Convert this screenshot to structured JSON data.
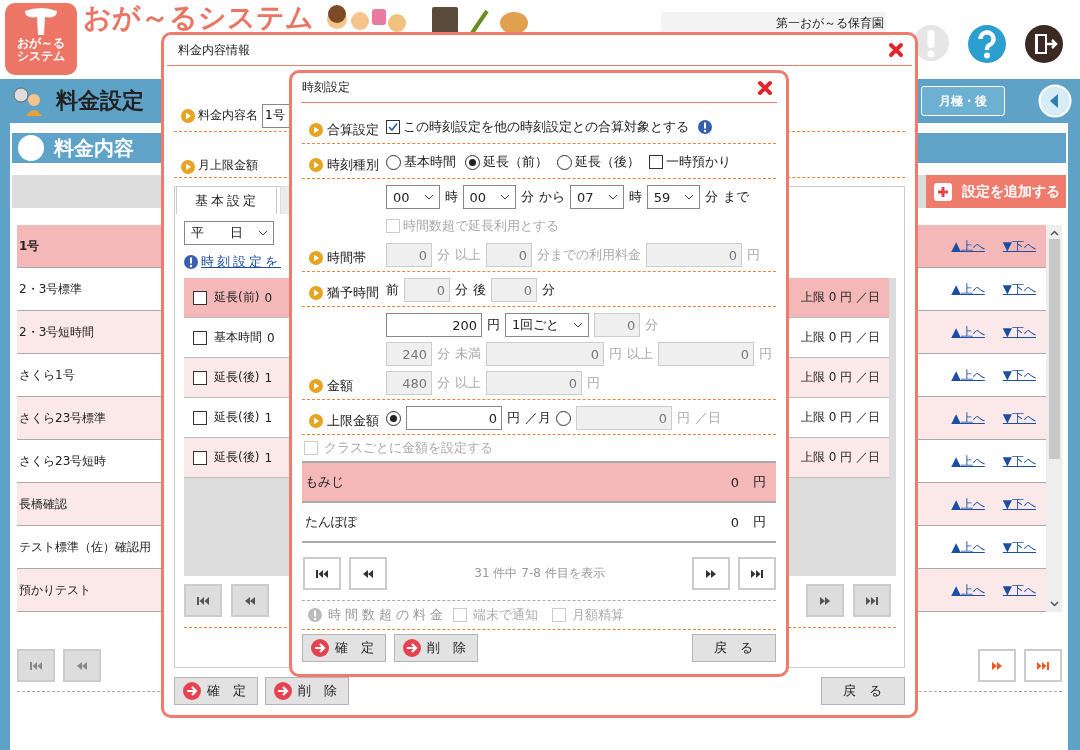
{
  "header": {
    "logo_lines": [
      "おが～る",
      "システム"
    ],
    "title": "おが～るシステム",
    "facility": "第一おが～る保育園"
  },
  "page_bar": {
    "title": "料金設定",
    "button": "月極・後"
  },
  "panel": {
    "title": "料金内容",
    "add_button": "設定を追加する",
    "rows": [
      {
        "name": "1号",
        "selected": true,
        "up": "▲上へ",
        "down": "▼下へ"
      },
      {
        "name": "2・3号標準",
        "selected": false,
        "up": "▲上へ",
        "down": "▼下へ"
      },
      {
        "name": "2・3号短時間",
        "selected": false,
        "up": "▲上へ",
        "down": "▼下へ"
      },
      {
        "name": "さくら1号",
        "selected": false,
        "up": "▲上へ",
        "down": "▼下へ"
      },
      {
        "name": "さくら23号標準",
        "selected": false,
        "up": "▲上へ",
        "down": "▼下へ"
      },
      {
        "name": "さくら23号短時",
        "selected": false,
        "up": "▲上へ",
        "down": "▼下へ"
      },
      {
        "name": "長橋確認",
        "selected": false,
        "up": "▲上へ",
        "down": "▼下へ"
      },
      {
        "name": "テスト標準（佐）確認用",
        "selected": false,
        "up": "▲上へ",
        "down": "▼下へ"
      },
      {
        "name": "預かりテスト",
        "selected": false,
        "up": "▲上へ",
        "down": "▼下へ"
      }
    ],
    "pager": [
      {
        "kind": "first",
        "disabled": true
      },
      {
        "kind": "prev",
        "disabled": true
      },
      {
        "kind": "next",
        "disabled": false
      },
      {
        "kind": "last",
        "disabled": false
      }
    ]
  },
  "fee_dialog": {
    "title": "料金内容情報",
    "fields": [
      {
        "label": "料金内容名",
        "value": "1号"
      },
      {
        "label": "月上限金額"
      }
    ],
    "tabs": [
      {
        "label": "基本設定",
        "selected": true
      },
      {
        "selected": false
      }
    ],
    "day_select": "平　　日",
    "info_link": "時刻設定を",
    "rows": [
      {
        "checked": false,
        "type": "延長(前)",
        "time": "0",
        "limit": "上限 0 円 ／日",
        "selected": true
      },
      {
        "checked": false,
        "type": "基本時間",
        "time": "0",
        "limit": "上限 0 円 ／日",
        "selected": false
      },
      {
        "checked": false,
        "type": "延長(後)",
        "time": "1",
        "limit": "上限 0 円 ／日",
        "selected": false
      },
      {
        "checked": false,
        "type": "延長(後)",
        "time": "1",
        "limit": "上限 0 円 ／日",
        "selected": false
      },
      {
        "checked": false,
        "type": "延長(後)",
        "time": "1",
        "limit": "上限 0 円 ／日",
        "selected": false
      }
    ],
    "pager": [
      {
        "kind": "first",
        "disabled": true
      },
      {
        "kind": "prev",
        "disabled": true
      },
      {
        "kind": "next",
        "disabled": true
      },
      {
        "kind": "last",
        "disabled": true
      }
    ],
    "buttons": [
      {
        "kind": "confirm",
        "label": "確　定"
      },
      {
        "kind": "delete",
        "label": "削　除"
      },
      {
        "kind": "back",
        "label": "戻　る"
      }
    ]
  },
  "time_dialog": {
    "title": "時刻設定",
    "sections": [
      {
        "label": "合算設定",
        "lines": [
          [
            {
              "kind": "checkbox",
              "label": "この時刻設定を他の時刻設定との合算対象とする",
              "checked": true,
              "disabled": false
            },
            {
              "kind": "info"
            }
          ]
        ]
      },
      {
        "label": "時刻種別",
        "lines": [
          [
            {
              "kind": "radio",
              "label": "基本時間",
              "selected": false
            },
            {
              "kind": "radio",
              "label": "延長（前）",
              "selected": true
            },
            {
              "kind": "radio",
              "label": "延長（後）",
              "selected": false
            },
            {
              "kind": "checkbox",
              "label": "一時預かり",
              "checked": false,
              "disabled": false
            }
          ]
        ]
      },
      {
        "label": "時間帯",
        "lines": [
          [
            {
              "kind": "select",
              "value": "00"
            },
            {
              "kind": "text",
              "text": "時",
              "disabled": false
            },
            {
              "kind": "select",
              "value": "00"
            },
            {
              "kind": "text",
              "text": "分",
              "disabled": false
            },
            {
              "kind": "text",
              "text": "から",
              "disabled": false
            },
            {
              "kind": "select",
              "value": "07"
            },
            {
              "kind": "text",
              "text": "時",
              "disabled": false
            },
            {
              "kind": "select",
              "value": "59"
            },
            {
              "kind": "text",
              "text": "分",
              "disabled": false
            },
            {
              "kind": "text",
              "text": "まで",
              "disabled": false
            }
          ],
          [
            {
              "kind": "checkbox",
              "label": "時間数超で延長利用とする",
              "checked": false,
              "disabled": true
            }
          ],
          [
            {
              "kind": "input",
              "value": "0",
              "disabled": true
            },
            {
              "kind": "text",
              "text": "分",
              "disabled": true
            },
            {
              "kind": "text",
              "text": "以上",
              "disabled": true
            },
            {
              "kind": "input",
              "value": "0",
              "disabled": true
            },
            {
              "kind": "text",
              "text": "分までの利用料金",
              "disabled": true
            },
            {
              "kind": "wideinput",
              "value": "0",
              "disabled": true
            },
            {
              "kind": "text",
              "text": "円",
              "disabled": true
            }
          ]
        ]
      },
      {
        "label": "猶予時間",
        "lines": [
          [
            {
              "kind": "text",
              "text": "前",
              "disabled": false
            },
            {
              "kind": "input",
              "value": "0",
              "disabled": true
            },
            {
              "kind": "text",
              "text": "分",
              "disabled": false
            },
            {
              "kind": "text",
              "text": "後",
              "disabled": false
            },
            {
              "kind": "input",
              "value": "0",
              "disabled": true
            },
            {
              "kind": "text",
              "text": "分",
              "disabled": false
            }
          ]
        ]
      },
      {
        "label": "金額",
        "lines": [
          [
            {
              "kind": "wideinput",
              "value": "200",
              "disabled": false
            },
            {
              "kind": "text",
              "text": "円",
              "disabled": false
            },
            {
              "kind": "select",
              "value": "1回ごと"
            },
            {
              "kind": "input",
              "value": "0",
              "disabled": true
            },
            {
              "kind": "text",
              "text": "分",
              "disabled": true
            }
          ],
          [
            {
              "kind": "input",
              "value": "240",
              "disabled": true
            },
            {
              "kind": "text",
              "text": "分",
              "disabled": true
            },
            {
              "kind": "text",
              "text": "未満",
              "disabled": true
            },
            {
              "kind": "longinput",
              "value": "0",
              "disabled": true
            },
            {
              "kind": "text",
              "text": "円",
              "disabled": true
            },
            {
              "kind": "text",
              "text": "以上",
              "disabled": true
            },
            {
              "kind": "wideinput",
              "value": "0",
              "disabled": true
            },
            {
              "kind": "text",
              "text": "円",
              "disabled": true
            }
          ],
          [
            {
              "kind": "input",
              "value": "480",
              "disabled": true
            },
            {
              "kind": "text",
              "text": "分",
              "disabled": true
            },
            {
              "kind": "text",
              "text": "以上",
              "disabled": true
            },
            {
              "kind": "wideinput",
              "value": "0",
              "disabled": true
            },
            {
              "kind": "text",
              "text": "円",
              "disabled": true
            }
          ]
        ]
      },
      {
        "label": "上限金額",
        "lines": [
          [
            {
              "kind": "radio",
              "selected": true
            },
            {
              "kind": "wideinput",
              "value": "0",
              "disabled": false
            },
            {
              "kind": "text",
              "text": "円",
              "disabled": false
            },
            {
              "kind": "text",
              "text": "／月",
              "disabled": false
            },
            {
              "kind": "radio",
              "selected": false
            },
            {
              "kind": "wideinput",
              "value": "0",
              "disabled": true
            },
            {
              "kind": "text",
              "text": "円",
              "disabled": true
            },
            {
              "kind": "text",
              "text": "／日",
              "disabled": true
            }
          ]
        ]
      }
    ],
    "class_toggle": {
      "label": "クラスごとに金額を設定する",
      "checked": false,
      "disabled": true
    },
    "class_rows": [
      {
        "name": "もみじ",
        "amount": "0",
        "unit": "円",
        "selected": true
      },
      {
        "name": "たんぽぽ",
        "amount": "0",
        "unit": "円",
        "selected": false
      }
    ],
    "pager": [
      {
        "kind": "first",
        "disabled": false
      },
      {
        "kind": "prev",
        "disabled": false
      },
      {
        "kind": "next",
        "disabled": false
      },
      {
        "kind": "last",
        "disabled": false
      }
    ],
    "page_info": "31 件中 7-8 件目を表示",
    "note": "時間数超の料金",
    "options": [
      {
        "label": "端末で通知",
        "checked": false,
        "disabled": true
      },
      {
        "label": "月額精算",
        "checked": false,
        "disabled": true
      }
    ],
    "buttons": [
      {
        "kind": "confirm",
        "label": "確　定"
      },
      {
        "kind": "delete",
        "label": "削　除"
      },
      {
        "kind": "back",
        "label": "戻　る"
      }
    ]
  }
}
